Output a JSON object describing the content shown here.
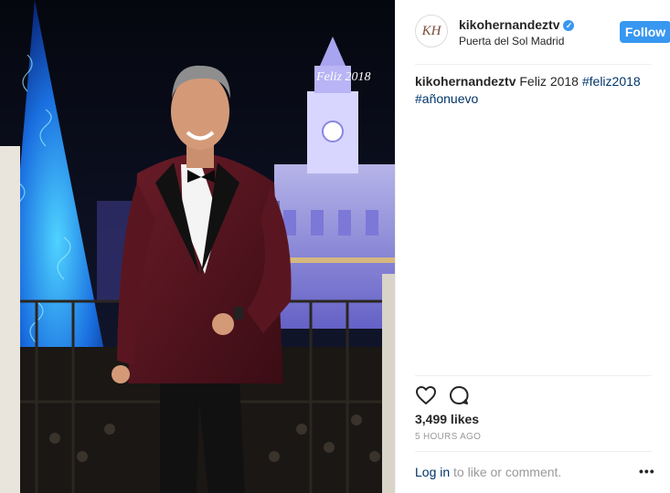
{
  "post": {
    "username": "kikohernandeztv",
    "avatar_initials": "KH",
    "location": "Puerta del Sol Madrid",
    "follow_label": "Follow",
    "caption_text": " Feliz 2018 ",
    "hashtags": [
      "#feliz2018",
      "#añonuevo"
    ],
    "likes": "3,499 likes",
    "time_ago": "5 HOURS AGO",
    "login_link": "Log in",
    "login_suffix": " to like or comment.",
    "more_label": "•••",
    "photo_sign": "Feliz 2018"
  },
  "colors": {
    "accent": "#3897f0",
    "hashtag": "#003569",
    "night_sky": "#0b0f24",
    "tree_blue": "#1e90ff",
    "jacket": "#5a1620"
  }
}
